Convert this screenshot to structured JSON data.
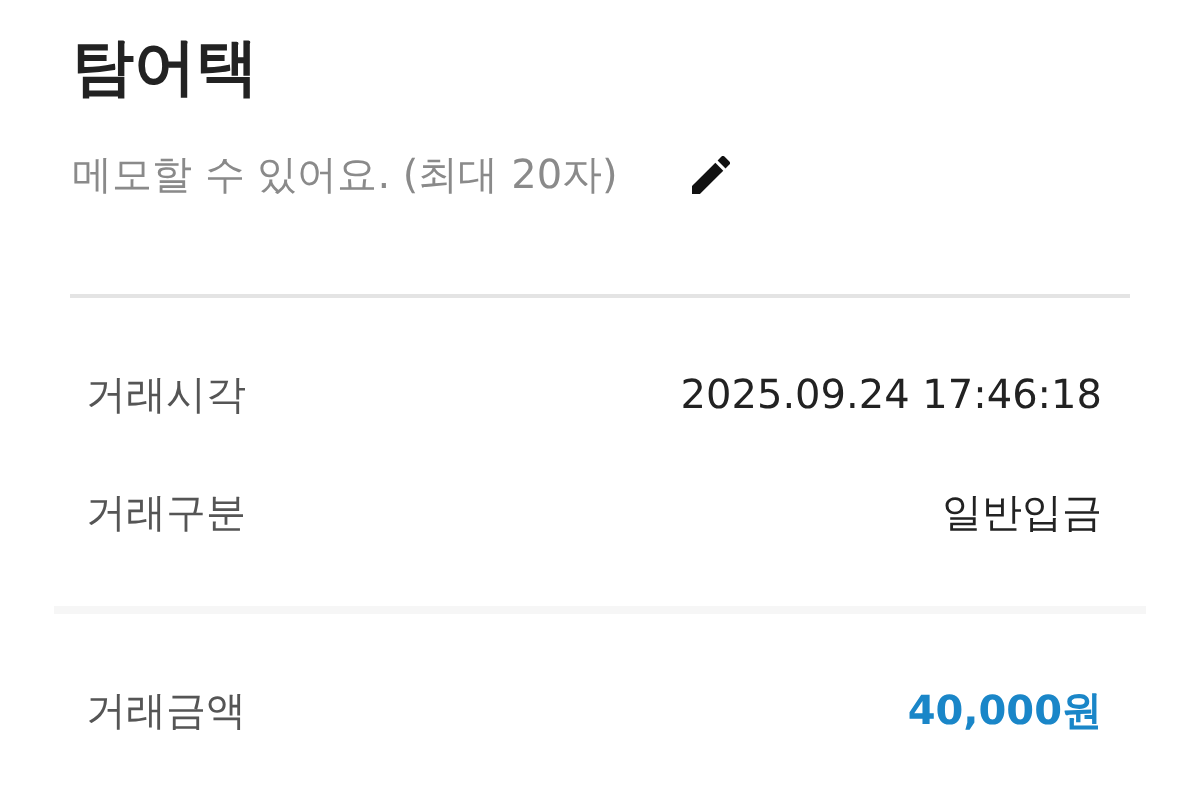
{
  "title": "탐어택",
  "memo": {
    "placeholder": "메모할 수 있어요. (최대 20자)"
  },
  "sections": [
    {
      "rows": [
        {
          "label": "거래시각",
          "value": "2025.09.24 17:46:18",
          "kind": "plain"
        },
        {
          "label": "거래구분",
          "value": "일반입금",
          "kind": "plain"
        }
      ]
    },
    {
      "rows": [
        {
          "label": "거래금액",
          "value": "40,000원",
          "kind": "amount"
        }
      ]
    }
  ]
}
